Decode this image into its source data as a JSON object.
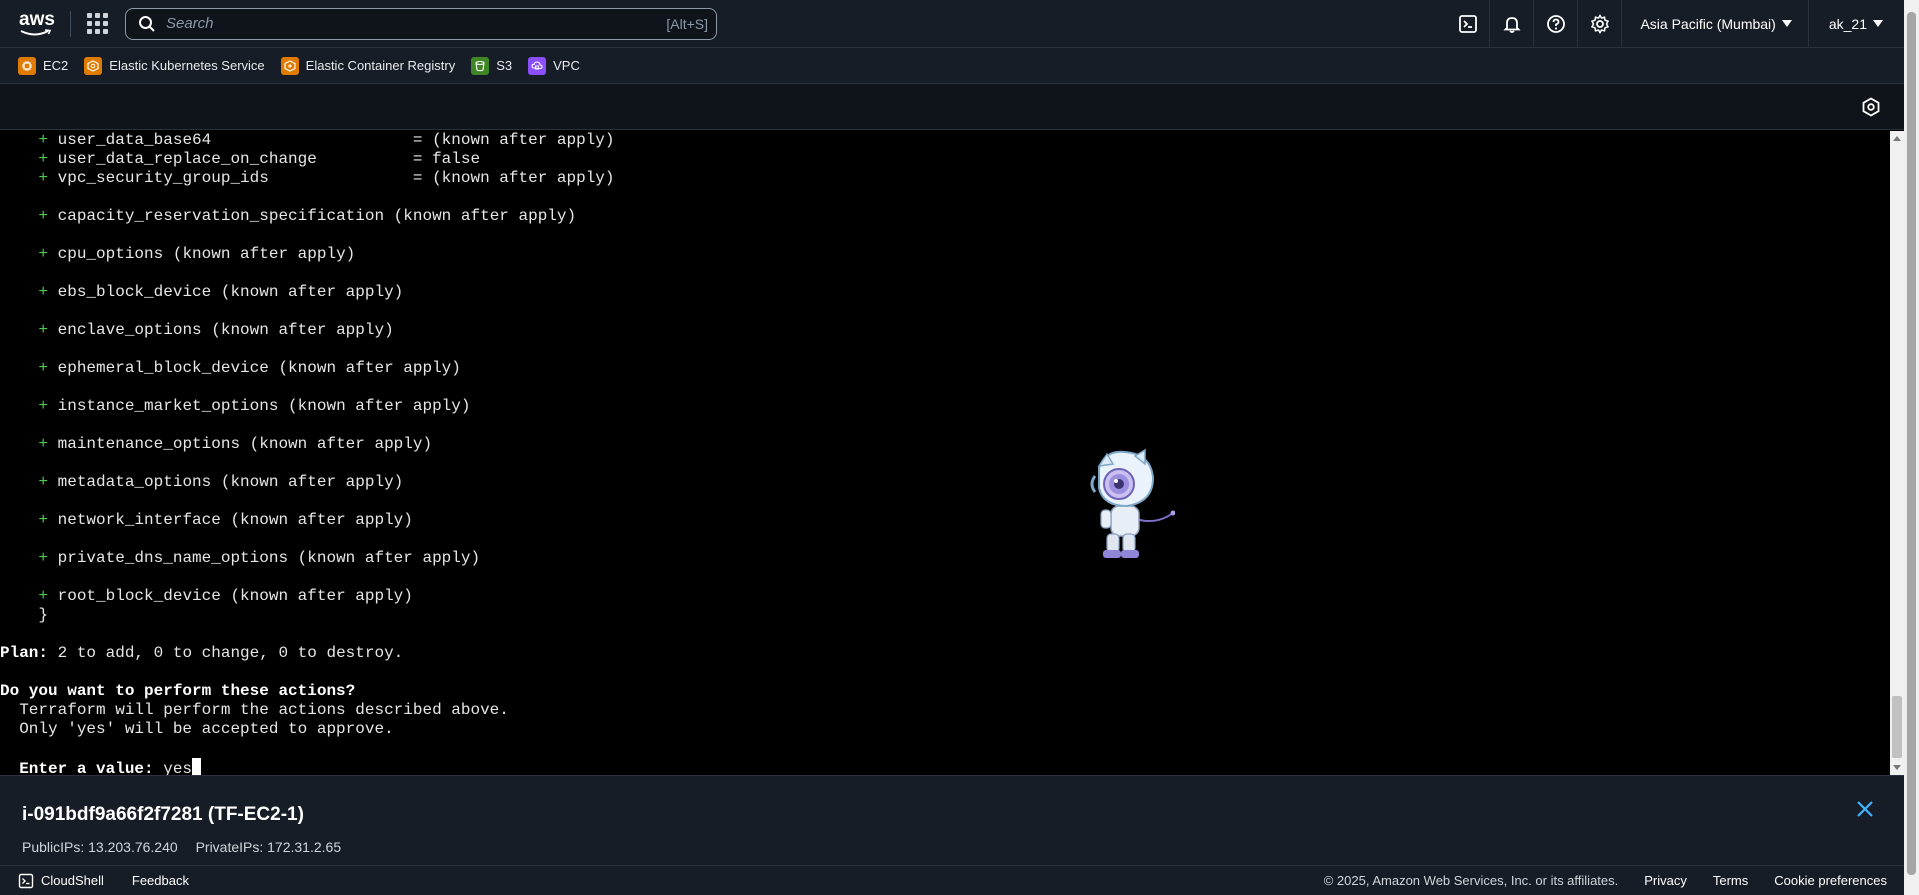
{
  "header": {
    "logo_text": "aws",
    "search_placeholder": "Search",
    "search_hint": "[Alt+S]",
    "region": "Asia Pacific (Mumbai)",
    "account": "ak_21"
  },
  "favorites": [
    {
      "label": "EC2",
      "icon": "ec2-icon",
      "color": "#e07b00"
    },
    {
      "label": "Elastic Kubernetes Service",
      "icon": "eks-icon",
      "color": "#e07b00"
    },
    {
      "label": "Elastic Container Registry",
      "icon": "ecr-icon",
      "color": "#e07b00"
    },
    {
      "label": "S3",
      "icon": "s3-icon",
      "color": "#3f8624"
    },
    {
      "label": "VPC",
      "icon": "vpc-icon",
      "color": "#8c4fff"
    }
  ],
  "terminal": {
    "lines": [
      {
        "indent": "    ",
        "plus": "+",
        "text": " user_data_base64                     = (known after apply)"
      },
      {
        "indent": "    ",
        "plus": "+",
        "text": " user_data_replace_on_change          = false"
      },
      {
        "indent": "    ",
        "plus": "+",
        "text": " vpc_security_group_ids               = (known after apply)"
      },
      {
        "indent": "",
        "plus": "",
        "text": ""
      },
      {
        "indent": "    ",
        "plus": "+",
        "text": " capacity_reservation_specification (known after apply)"
      },
      {
        "indent": "",
        "plus": "",
        "text": ""
      },
      {
        "indent": "    ",
        "plus": "+",
        "text": " cpu_options (known after apply)"
      },
      {
        "indent": "",
        "plus": "",
        "text": ""
      },
      {
        "indent": "    ",
        "plus": "+",
        "text": " ebs_block_device (known after apply)"
      },
      {
        "indent": "",
        "plus": "",
        "text": ""
      },
      {
        "indent": "    ",
        "plus": "+",
        "text": " enclave_options (known after apply)"
      },
      {
        "indent": "",
        "plus": "",
        "text": ""
      },
      {
        "indent": "    ",
        "plus": "+",
        "text": " ephemeral_block_device (known after apply)"
      },
      {
        "indent": "",
        "plus": "",
        "text": ""
      },
      {
        "indent": "    ",
        "plus": "+",
        "text": " instance_market_options (known after apply)"
      },
      {
        "indent": "",
        "plus": "",
        "text": ""
      },
      {
        "indent": "    ",
        "plus": "+",
        "text": " maintenance_options (known after apply)"
      },
      {
        "indent": "",
        "plus": "",
        "text": ""
      },
      {
        "indent": "    ",
        "plus": "+",
        "text": " metadata_options (known after apply)"
      },
      {
        "indent": "",
        "plus": "",
        "text": ""
      },
      {
        "indent": "    ",
        "plus": "+",
        "text": " network_interface (known after apply)"
      },
      {
        "indent": "",
        "plus": "",
        "text": ""
      },
      {
        "indent": "    ",
        "plus": "+",
        "text": " private_dns_name_options (known after apply)"
      },
      {
        "indent": "",
        "plus": "",
        "text": ""
      },
      {
        "indent": "    ",
        "plus": "+",
        "text": " root_block_device (known after apply)"
      },
      {
        "indent": "",
        "plus": "",
        "text": "    }"
      },
      {
        "indent": "",
        "plus": "",
        "text": ""
      }
    ],
    "plan_label": "Plan:",
    "plan_text": " 2 to add, 0 to change, 0 to destroy.",
    "question": "Do you want to perform these actions?",
    "desc1": "  Terraform will perform the actions described above.",
    "desc2": "  Only 'yes' will be accepted to approve.",
    "prompt_label": "  Enter a value:",
    "prompt_value": " yes"
  },
  "instance": {
    "title": "i-091bdf9a66f2f7281 (TF-EC2-1)",
    "public_ips": "PublicIPs: 13.203.76.240",
    "private_ips": "PrivateIPs: 172.31.2.65"
  },
  "footer": {
    "cloudshell": "CloudShell",
    "feedback": "Feedback",
    "copyright": "© 2025, Amazon Web Services, Inc. or its affiliates.",
    "privacy": "Privacy",
    "terms": "Terms",
    "cookies": "Cookie preferences"
  }
}
